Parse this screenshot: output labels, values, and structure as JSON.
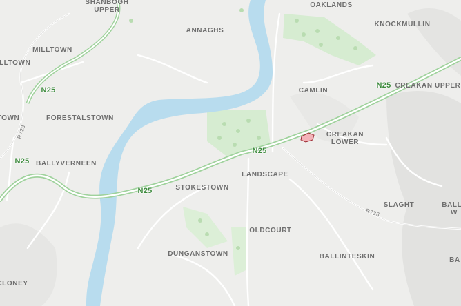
{
  "map": {
    "colors": {
      "land": "#eeeeec",
      "water": "#b8dcee",
      "motorway_casing": "#9fd29c",
      "motorway_fill": "#ffffff",
      "minor_road": "#ffffff",
      "park": "#d6ecd1",
      "property_fill": "#f3b3b8",
      "property_stroke": "#9c2a33"
    },
    "townlands": [
      {
        "id": "shanbogh-upper",
        "text": "SHANBOGH\nUPPER"
      },
      {
        "id": "annaghs",
        "text": "ANNAGHS"
      },
      {
        "id": "oaklands",
        "text": "OAKLANDS"
      },
      {
        "id": "knockmullin",
        "text": "KNOCKMULLIN"
      },
      {
        "id": "milltown",
        "text": "MILLTOWN"
      },
      {
        "id": "illtown",
        "text": "ILLTOWN"
      },
      {
        "id": "camlin",
        "text": "CAMLIN"
      },
      {
        "id": "creakan-upper",
        "text": "CREAKAN UPPER"
      },
      {
        "id": "forestalstown",
        "text": "FORESTALSTOWN"
      },
      {
        "id": "town",
        "text": "TOWN"
      },
      {
        "id": "creakan-lower",
        "text": "CREAKAN\nLOWER"
      },
      {
        "id": "ballyverneen",
        "text": "BALLYVERNEEN"
      },
      {
        "id": "landscape",
        "text": "LANDSCAPE"
      },
      {
        "id": "stokestown",
        "text": "STOKESTOWN"
      },
      {
        "id": "slaght",
        "text": "SLAGHT"
      },
      {
        "id": "bally-edge",
        "text": "BALLY\nW"
      },
      {
        "id": "oldcourt",
        "text": "OLDCOURT"
      },
      {
        "id": "dunganstown",
        "text": "DUNGANSTOWN"
      },
      {
        "id": "ballinteskin",
        "text": "BALLINTESKIN"
      },
      {
        "id": "ba-edge",
        "text": "BA"
      },
      {
        "id": "cloney",
        "text": "CLONEY"
      }
    ],
    "roads": [
      {
        "id": "n25-a",
        "text": "N25"
      },
      {
        "id": "n25-b",
        "text": "N25"
      },
      {
        "id": "n25-c",
        "text": "N25"
      },
      {
        "id": "n25-d",
        "text": "N25"
      },
      {
        "id": "n25-e",
        "text": "N25"
      },
      {
        "id": "r723",
        "text": "R723"
      },
      {
        "id": "r733",
        "text": "R733"
      }
    ]
  }
}
